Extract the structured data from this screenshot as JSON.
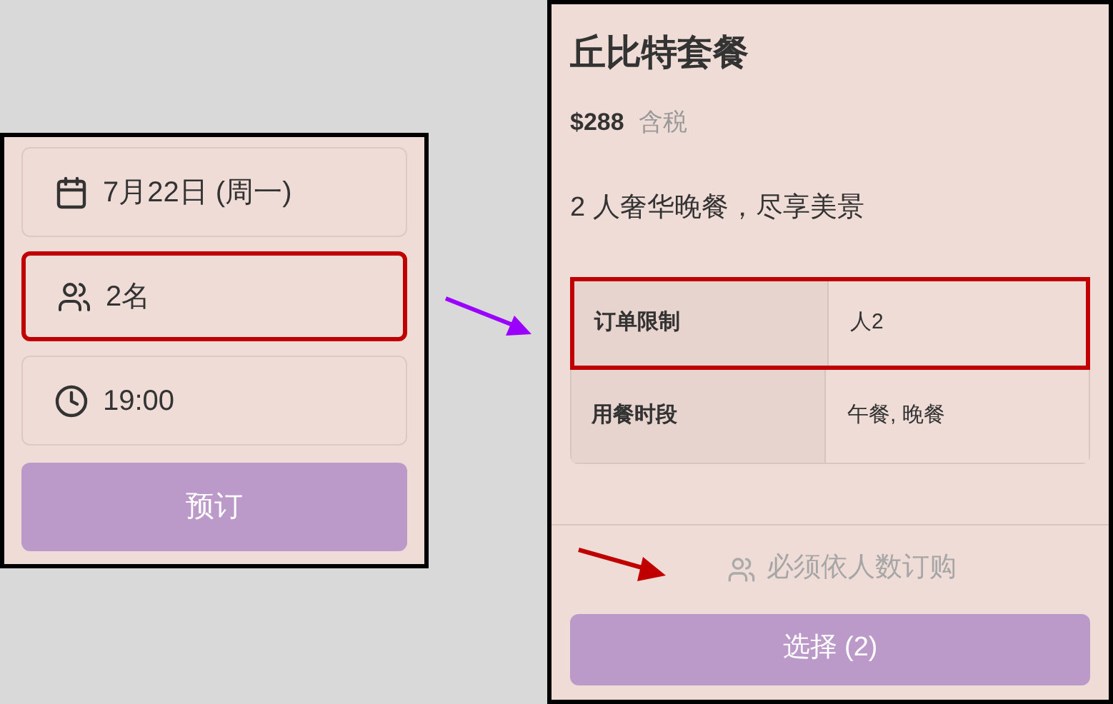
{
  "booking": {
    "fields": [
      {
        "kind": "date",
        "value": "7月22日 (周一)",
        "highlighted": false
      },
      {
        "kind": "guests",
        "value": "2名",
        "highlighted": true
      },
      {
        "kind": "time",
        "value": "19:00",
        "highlighted": false
      }
    ],
    "button": "预订"
  },
  "menu": {
    "title": "丘比特套餐",
    "price": "$288",
    "tax_note": "含税",
    "description": "2 人奢华晚餐，尽享美景",
    "details": [
      {
        "label": "订单限制",
        "value": "人2",
        "highlighted": true
      },
      {
        "label": "用餐时段",
        "value": "午餐, 晚餐",
        "highlighted": false
      }
    ],
    "notice": "必须依人数订购",
    "button": "选择 (2)"
  }
}
